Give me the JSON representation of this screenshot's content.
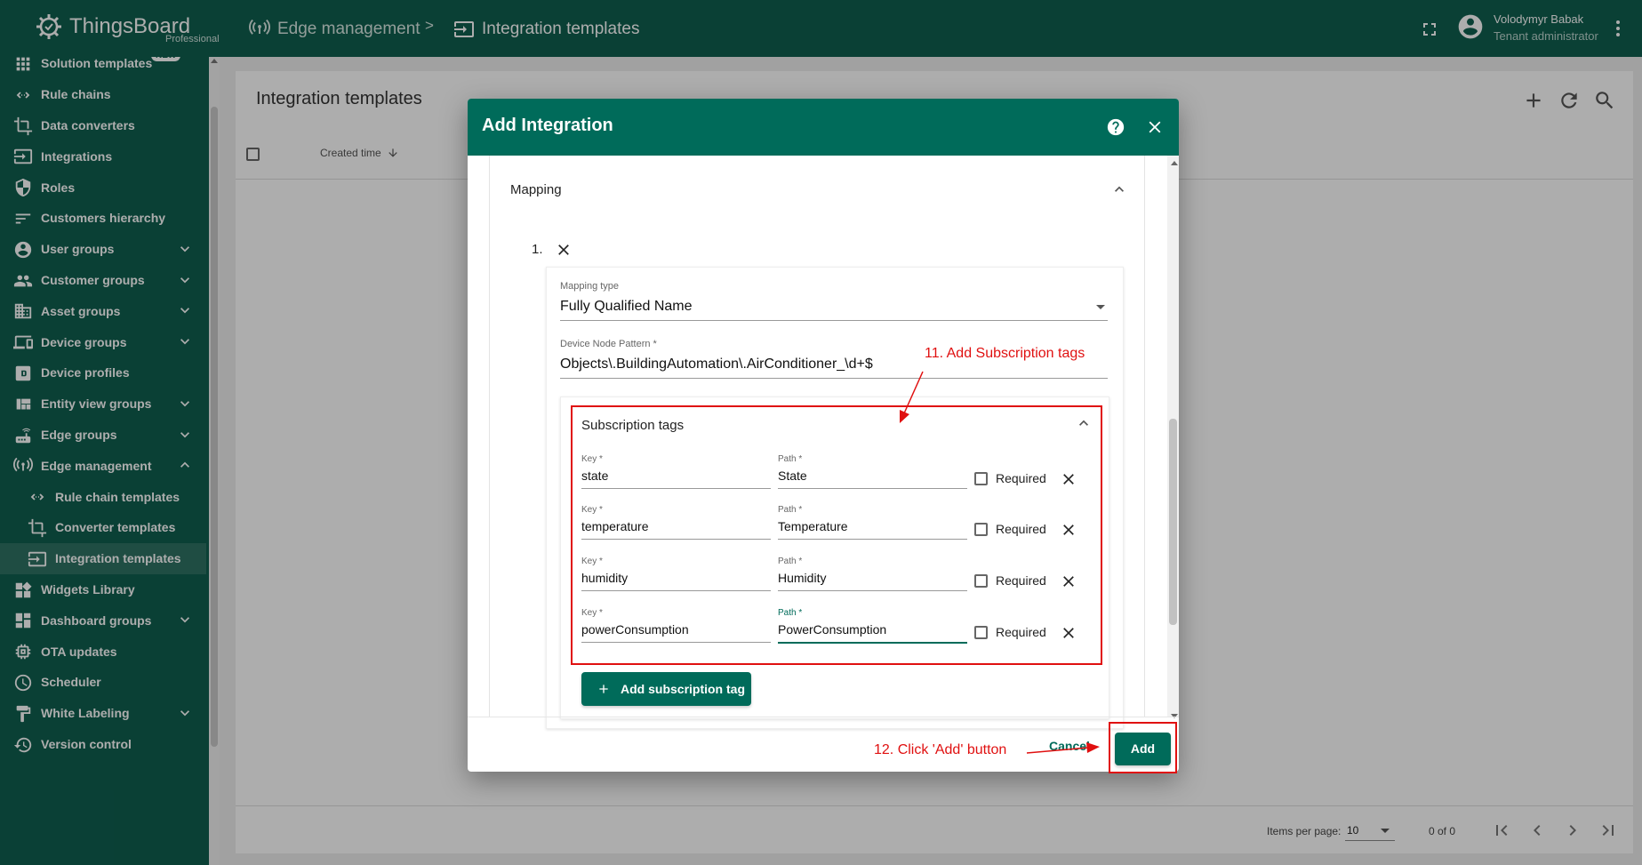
{
  "app": {
    "name": "ThingsBoard",
    "edition": "Professional"
  },
  "breadcrumb": {
    "parent": "Edge management",
    "separator": ">",
    "current": "Integration templates"
  },
  "user": {
    "name": "Volodymyr Babak",
    "role": "Tenant administrator"
  },
  "sidebar": {
    "items": [
      {
        "label": "Solution templates",
        "icon": "grid-icon",
        "badge": "NEW"
      },
      {
        "label": "Rule chains",
        "icon": "code-arrows-icon"
      },
      {
        "label": "Data converters",
        "icon": "crop-icon"
      },
      {
        "label": "Integrations",
        "icon": "input-icon"
      },
      {
        "label": "Roles",
        "icon": "shield-icon"
      },
      {
        "label": "Customers hierarchy",
        "icon": "sort-lines-icon"
      },
      {
        "label": "User groups",
        "icon": "account-circle-icon",
        "expandable": true
      },
      {
        "label": "Customer groups",
        "icon": "people-icon",
        "expandable": true
      },
      {
        "label": "Asset groups",
        "icon": "domain-icon",
        "expandable": true
      },
      {
        "label": "Device groups",
        "icon": "devices-icon",
        "expandable": true
      },
      {
        "label": "Device profiles",
        "icon": "profile-badge-icon"
      },
      {
        "label": "Entity view groups",
        "icon": "view-quilt-icon",
        "expandable": true
      },
      {
        "label": "Edge groups",
        "icon": "router-icon",
        "expandable": true
      },
      {
        "label": "Edge management",
        "icon": "antenna-icon",
        "expanded": true
      },
      {
        "label": "Rule chain templates",
        "icon": "code-arrows-icon",
        "sub": true
      },
      {
        "label": "Converter templates",
        "icon": "crop-icon",
        "sub": true
      },
      {
        "label": "Integration templates",
        "icon": "input-icon",
        "sub": true,
        "active": true
      },
      {
        "label": "Widgets Library",
        "icon": "widgets-icon"
      },
      {
        "label": "Dashboard groups",
        "icon": "dashboard-icon",
        "expandable": true
      },
      {
        "label": "OTA updates",
        "icon": "memory-chip-icon"
      },
      {
        "label": "Scheduler",
        "icon": "clock-icon"
      },
      {
        "label": "White Labeling",
        "icon": "paint-roller-icon",
        "expandable": true
      },
      {
        "label": "Version control",
        "icon": "history-icon"
      }
    ]
  },
  "page": {
    "title": "Integration templates",
    "column_created": "Created time",
    "items_per_page_label": "Items per page:",
    "items_per_page_value": "10",
    "page_range": "0 of 0"
  },
  "dialog": {
    "title": "Add Integration",
    "mapping_title": "Mapping",
    "mapping_index": "1.",
    "mapping_type_label": "Mapping type",
    "mapping_type_value": "Fully Qualified Name",
    "device_node_pattern_label": "Device Node Pattern *",
    "device_node_pattern_value": "Objects\\.BuildingAutomation\\.AirConditioner_\\d+$",
    "subscription_tags_title": "Subscription tags",
    "key_label": "Key *",
    "path_label": "Path *",
    "required_label": "Required",
    "tags": [
      {
        "key": "state",
        "path": "State"
      },
      {
        "key": "temperature",
        "path": "Temperature"
      },
      {
        "key": "humidity",
        "path": "Humidity"
      },
      {
        "key": "powerConsumption",
        "path": "PowerConsumption"
      }
    ],
    "add_tag_label": "Add subscription tag",
    "cancel_label": "Cancel",
    "add_label": "Add"
  },
  "annotations": {
    "step11": "11. Add Subscription tags",
    "step12": "12. Click 'Add' button"
  },
  "colors": {
    "brand": "#0f5f4f",
    "accent": "#006b5a",
    "annotation": "#e01010"
  }
}
